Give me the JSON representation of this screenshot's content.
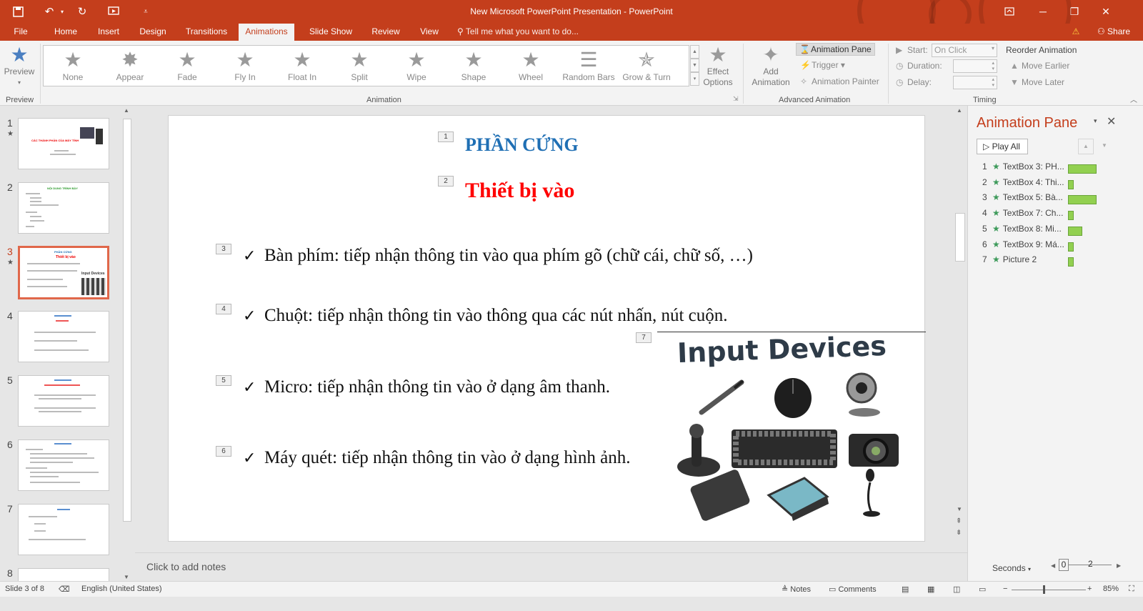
{
  "window": {
    "title": "New Microsoft PowerPoint Presentation - PowerPoint"
  },
  "menu": {
    "file": "File",
    "tabs": [
      "Home",
      "Insert",
      "Design",
      "Transitions",
      "Animations",
      "Slide Show",
      "Review",
      "View"
    ],
    "active_tab": "Animations",
    "tell_me": "Tell me what you want to do...",
    "share": "Share"
  },
  "ribbon": {
    "preview_label": "Preview",
    "effects": [
      "None",
      "Appear",
      "Fade",
      "Fly In",
      "Float In",
      "Split",
      "Wipe",
      "Shape",
      "Wheel",
      "Random Bars",
      "Grow & Turn"
    ],
    "effect_options": [
      "Effect",
      "Options"
    ],
    "add_animation": [
      "Add",
      "Animation"
    ],
    "animation_pane_btn": "Animation Pane",
    "trigger": "Trigger",
    "animation_painter": "Animation Painter",
    "start_label": "Start:",
    "start_value": "On Click",
    "duration_label": "Duration:",
    "delay_label": "Delay:",
    "reorder_title": "Reorder Animation",
    "move_earlier": "Move Earlier",
    "move_later": "Move Later",
    "groups": {
      "preview": "Preview",
      "animation": "Animation",
      "advanced": "Advanced Animation",
      "timing": "Timing"
    }
  },
  "thumbnails": {
    "numbers": [
      "1",
      "2",
      "3",
      "4",
      "5",
      "6",
      "7",
      "8"
    ],
    "selected": "3",
    "thumb1_title": "CÁC THÀNH PHẦN CỦA MÁY TÍNH",
    "thumb2_title": "NỘI DUNG TRÌNH BÀY",
    "thumb3_title": "PHẦN CỨNG",
    "thumb3_sub": "Thiết bị vào",
    "thumb3_img": "Input Devices"
  },
  "slide": {
    "tags": [
      "1",
      "2",
      "3",
      "4",
      "5",
      "6",
      "7"
    ],
    "title": "PHẦN CỨNG",
    "subtitle": "Thiết bị vào",
    "check": "✓",
    "bullets": [
      "Bàn phím: tiếp nhận thông tin vào qua phím gõ (chữ cái, chữ số, …)",
      "Chuột: tiếp nhận thông tin vào thông qua các nút nhấn, nút cuộn.",
      "Micro: tiếp nhận thông tin vào ở dạng âm thanh.",
      "Máy quét: tiếp nhận thông tin vào ở dạng hình ảnh."
    ],
    "image_title": "Input Devices"
  },
  "notes_placeholder": "Click to add notes",
  "animation_pane": {
    "title": "Animation Pane",
    "play_all": "Play All",
    "items": [
      {
        "num": "1",
        "label": "TextBox 3: PH...",
        "duration": 1.0
      },
      {
        "num": "2",
        "label": "TextBox 4: Thi...",
        "duration": 0.2
      },
      {
        "num": "3",
        "label": "TextBox 5: Bà...",
        "duration": 1.0
      },
      {
        "num": "4",
        "label": "TextBox 7: Ch...",
        "duration": 0.2
      },
      {
        "num": "5",
        "label": "TextBox 8: Mi...",
        "duration": 0.5
      },
      {
        "num": "6",
        "label": "TextBox 9: Má...",
        "duration": 0.2
      },
      {
        "num": "7",
        "label": "Picture 2",
        "duration": 0.2
      }
    ],
    "seconds": "Seconds",
    "timeline_start": "0",
    "timeline_end": "2"
  },
  "status": {
    "slide_info": "Slide 3 of 8",
    "language": "English (United States)",
    "notes": "Notes",
    "comments": "Comments",
    "zoom": "85%"
  },
  "colors": {
    "accent": "#c43e1c",
    "title_blue": "#1f6fb4",
    "subtitle_red": "#ff0000",
    "bar_green": "#92d050"
  }
}
